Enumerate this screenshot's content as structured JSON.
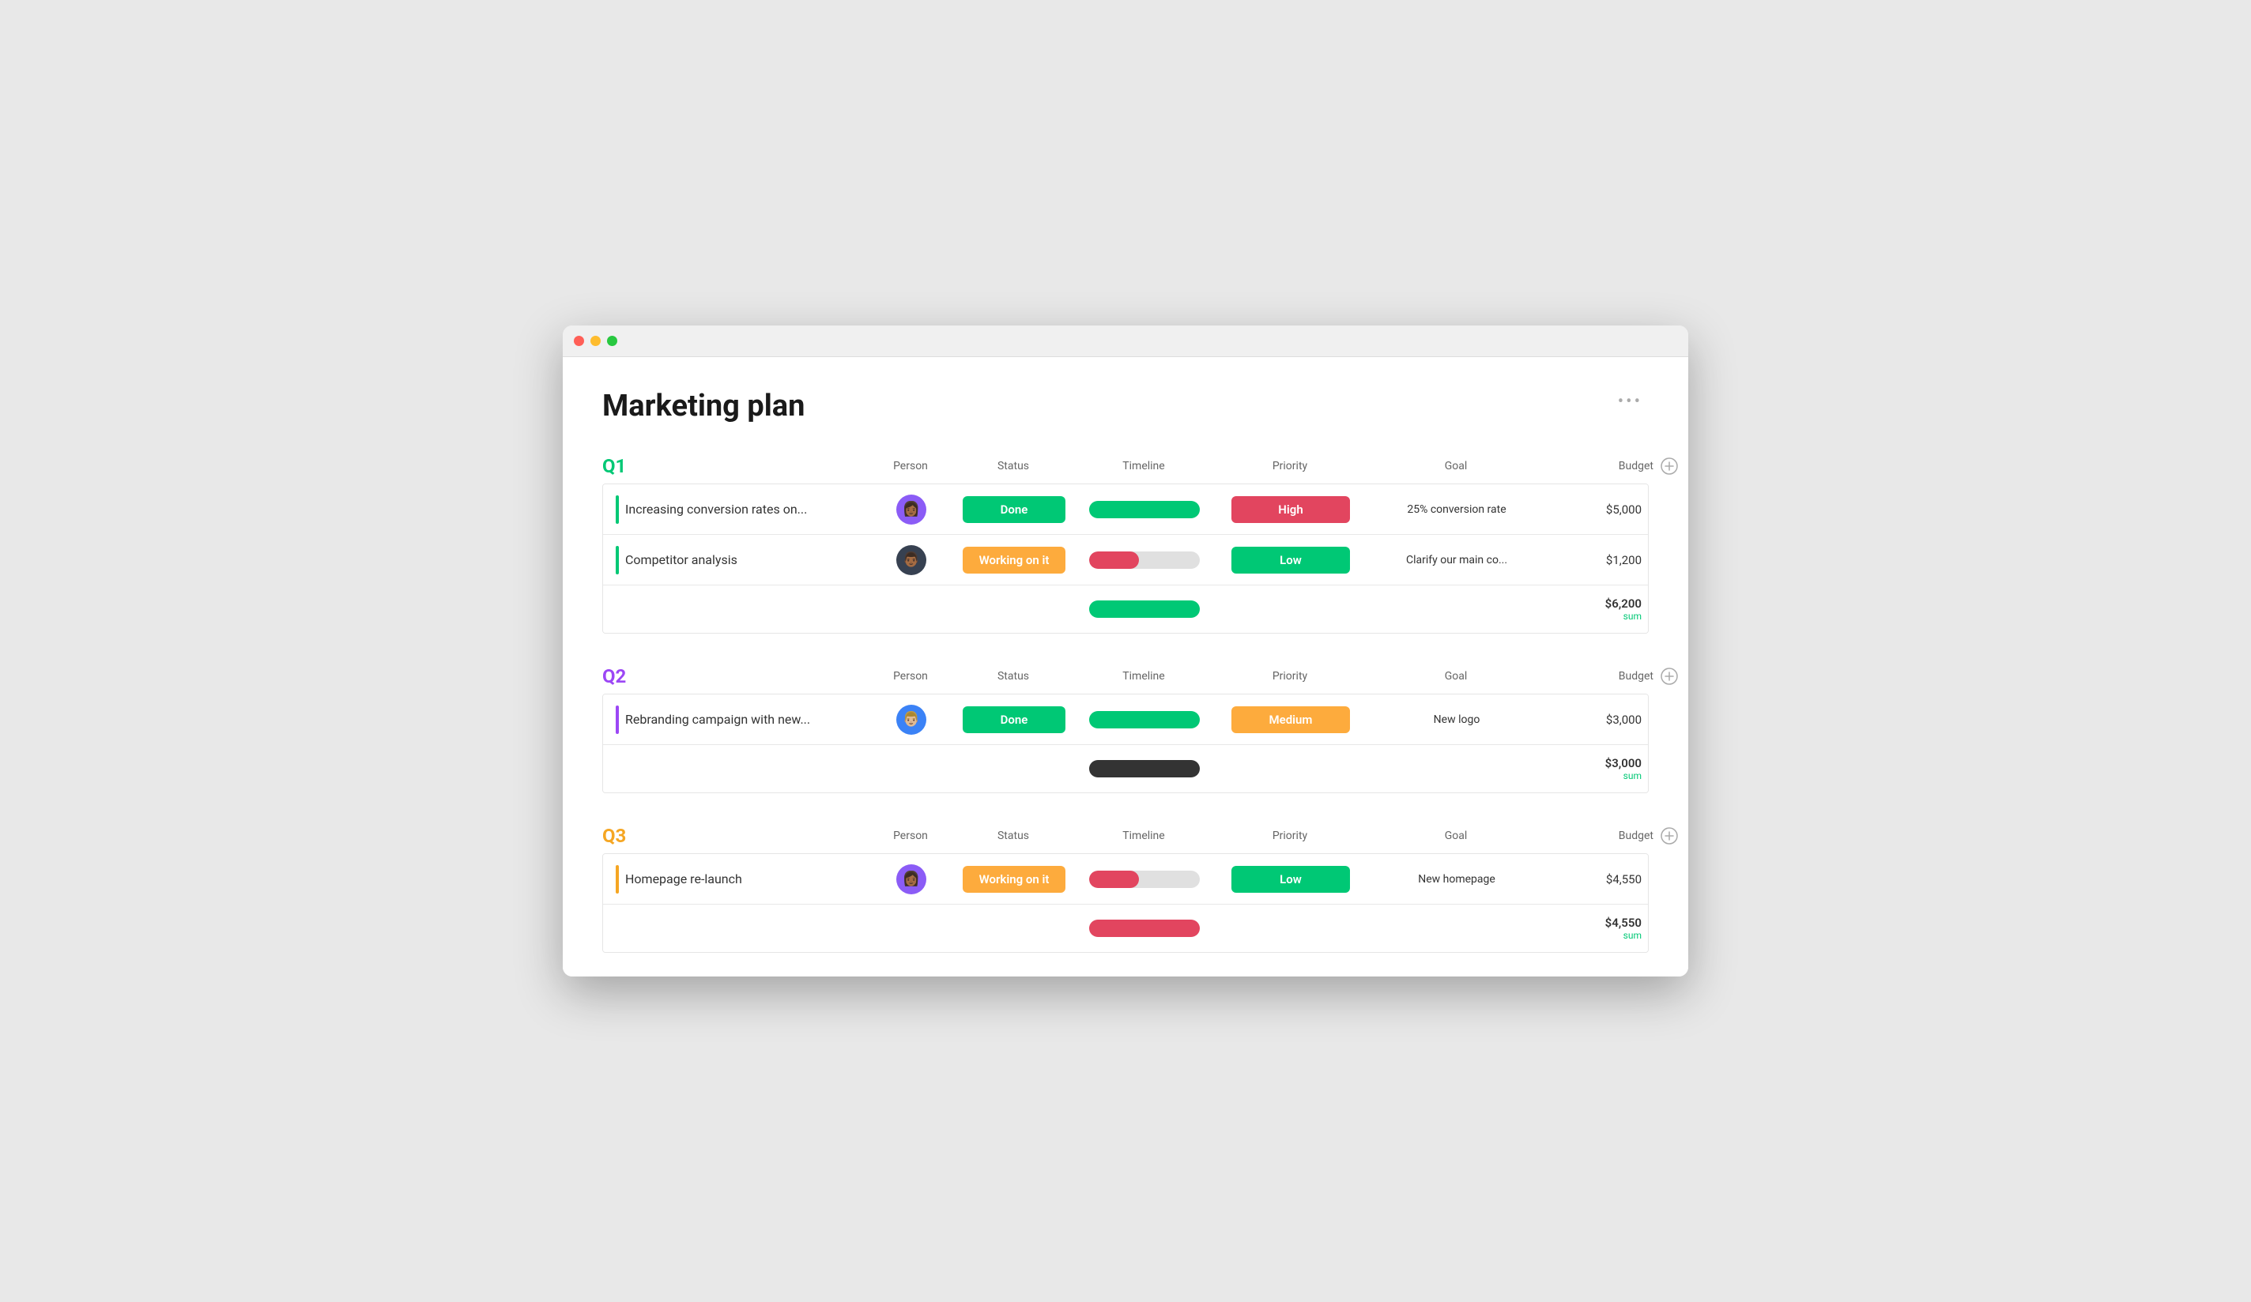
{
  "window": {
    "title": "Marketing plan"
  },
  "page": {
    "title": "Marketing plan",
    "more_icon": "•••"
  },
  "sections": [
    {
      "id": "q1",
      "label": "Q1",
      "color_class": "q1-color",
      "bar_color": "#00c875",
      "columns": [
        "Person",
        "Status",
        "Timeline",
        "Priority",
        "Goal",
        "Budget"
      ],
      "rows": [
        {
          "task": "Increasing conversion rates on...",
          "avatar_emoji": "👩🏾",
          "avatar_class": "avatar-1",
          "status": "Done",
          "status_class": "status-done",
          "timeline_fill": 100,
          "timeline_color": "#00c875",
          "timeline_full": true,
          "priority": "High",
          "priority_class": "priority-high",
          "goal": "25% conversion rate",
          "budget": "$5,000"
        },
        {
          "task": "Competitor analysis",
          "avatar_emoji": "👨🏾",
          "avatar_class": "avatar-2",
          "status": "Working on it",
          "status_class": "status-working",
          "timeline_fill": 45,
          "timeline_color": "#e2455f",
          "timeline_full": false,
          "priority": "Low",
          "priority_class": "priority-low",
          "goal": "Clarify our main co...",
          "budget": "$1,200"
        }
      ],
      "summary": {
        "timeline_color": "#00c875",
        "amount": "$6,200",
        "label": "sum"
      }
    },
    {
      "id": "q2",
      "label": "Q2",
      "color_class": "q2-color",
      "bar_color": "#9c47f5",
      "columns": [
        "Person",
        "Status",
        "Timeline",
        "Priority",
        "Goal",
        "Budget"
      ],
      "rows": [
        {
          "task": "Rebranding campaign with new...",
          "avatar_emoji": "👨🏼",
          "avatar_class": "avatar-3",
          "status": "Done",
          "status_class": "status-done",
          "timeline_fill": 100,
          "timeline_color": "#00c875",
          "timeline_full": true,
          "priority": "Medium",
          "priority_class": "priority-medium",
          "goal": "New logo",
          "budget": "$3,000"
        }
      ],
      "summary": {
        "timeline_color": "#333",
        "amount": "$3,000",
        "label": "sum"
      }
    },
    {
      "id": "q3",
      "label": "Q3",
      "color_class": "q3-color",
      "bar_color": "#f5a623",
      "columns": [
        "Person",
        "Status",
        "Timeline",
        "Priority",
        "Goal",
        "Budget"
      ],
      "rows": [
        {
          "task": "Homepage re-launch",
          "avatar_emoji": "👩🏾",
          "avatar_class": "avatar-4",
          "status": "Working on it",
          "status_class": "status-working",
          "timeline_fill": 45,
          "timeline_color": "#e2455f",
          "timeline_full": false,
          "priority": "Low",
          "priority_class": "priority-low",
          "goal": "New homepage",
          "budget": "$4,550"
        }
      ],
      "summary": {
        "timeline_color": "#e2455f",
        "amount": "$4,550",
        "label": "sum"
      }
    }
  ]
}
